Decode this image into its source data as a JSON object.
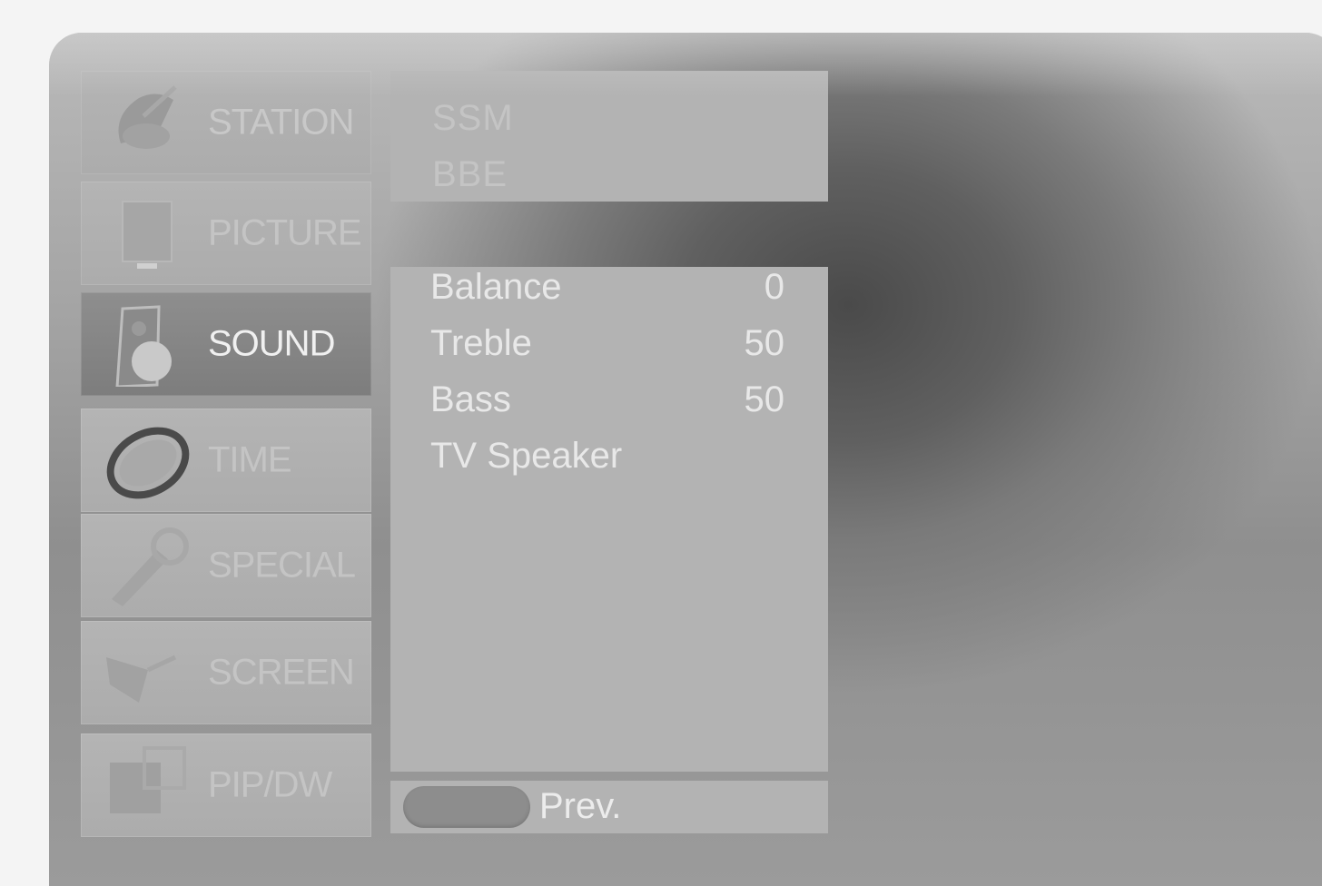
{
  "sidebar": {
    "items": [
      {
        "label": "STATION",
        "icon": "satellite-dish-icon"
      },
      {
        "label": "PICTURE",
        "icon": "monitor-icon"
      },
      {
        "label": "SOUND",
        "icon": "speaker-icon",
        "active": true
      },
      {
        "label": "TIME",
        "icon": "clock-icon"
      },
      {
        "label": "SPECIAL",
        "icon": "wrench-icon"
      },
      {
        "label": "SCREEN",
        "icon": "screen-icon"
      },
      {
        "label": "PIP/DW",
        "icon": "pip-icon"
      }
    ]
  },
  "submenu": {
    "ghost": [
      "SSM",
      "BBE"
    ],
    "rows": [
      {
        "name": "Balance",
        "value": "0"
      },
      {
        "name": "Treble",
        "value": "50"
      },
      {
        "name": "Bass",
        "value": "50"
      },
      {
        "name": "TV Speaker",
        "value": ""
      }
    ]
  },
  "footer": {
    "prev_label": "Prev."
  }
}
